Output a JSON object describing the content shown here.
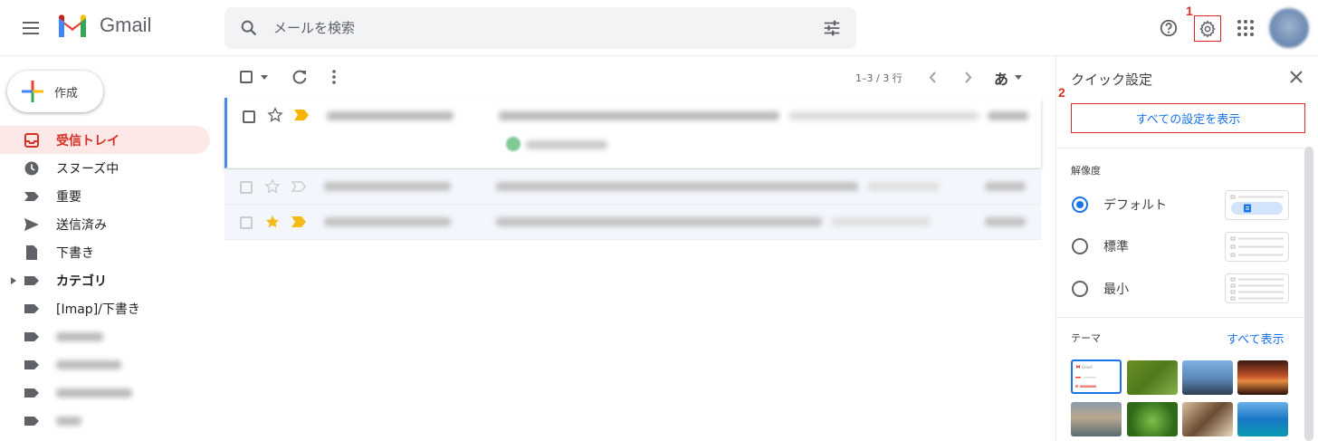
{
  "app": {
    "name": "Gmail"
  },
  "search": {
    "placeholder": "メールを検索"
  },
  "markers": {
    "one": "1",
    "two": "2"
  },
  "compose": {
    "label": "作成"
  },
  "sidebar": {
    "items": [
      {
        "label": "受信トレイ",
        "icon": "inbox-icon"
      },
      {
        "label": "スヌーズ中",
        "icon": "clock-icon"
      },
      {
        "label": "重要",
        "icon": "label-important-icon"
      },
      {
        "label": "送信済み",
        "icon": "send-icon"
      },
      {
        "label": "下書き",
        "icon": "draft-icon"
      },
      {
        "label": "カテゴリ",
        "icon": "label-icon"
      },
      {
        "label": "[Imap]/下書き",
        "icon": "label-icon"
      }
    ]
  },
  "toolbar": {
    "page_info": "1–3 / 3 行",
    "input_tool": "あ"
  },
  "quick_settings": {
    "title": "クイック設定",
    "all_settings_button": "すべての設定を表示",
    "density_label": "解像度",
    "density_options": [
      {
        "label": "デフォルト",
        "selected": true
      },
      {
        "label": "標準",
        "selected": false
      },
      {
        "label": "最小",
        "selected": false
      }
    ],
    "theme_label": "テーマ",
    "see_all": "すべて表示",
    "theme_thumb_label": "Gmail"
  },
  "colors": {
    "accent": "#1a73e8",
    "active_bg": "#fce8e6",
    "active_text": "#d93025",
    "highlight_box": "#d93025",
    "important": "#f4b400"
  }
}
